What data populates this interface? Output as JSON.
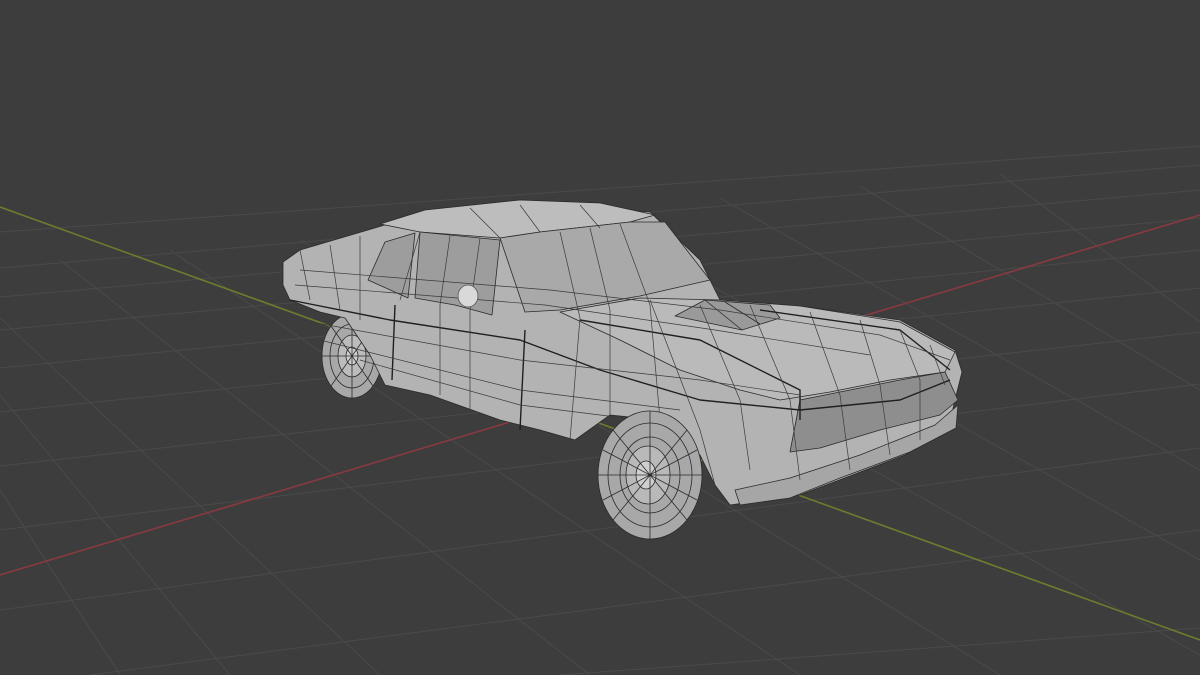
{
  "viewport": {
    "mode": "3d-viewport",
    "object": "car-model",
    "display": "wireframe-overlay-solid",
    "colors": {
      "background": "#3d3d3d",
      "grid_line": "#4a4a4a",
      "x_axis": "#8a3a3f",
      "y_axis": "#6b7d2e",
      "model_fill": "#b7b7b7",
      "model_shade": "#9c9c9c",
      "model_dark": "#8a8a8a",
      "wire": "#2a2a2a"
    }
  }
}
